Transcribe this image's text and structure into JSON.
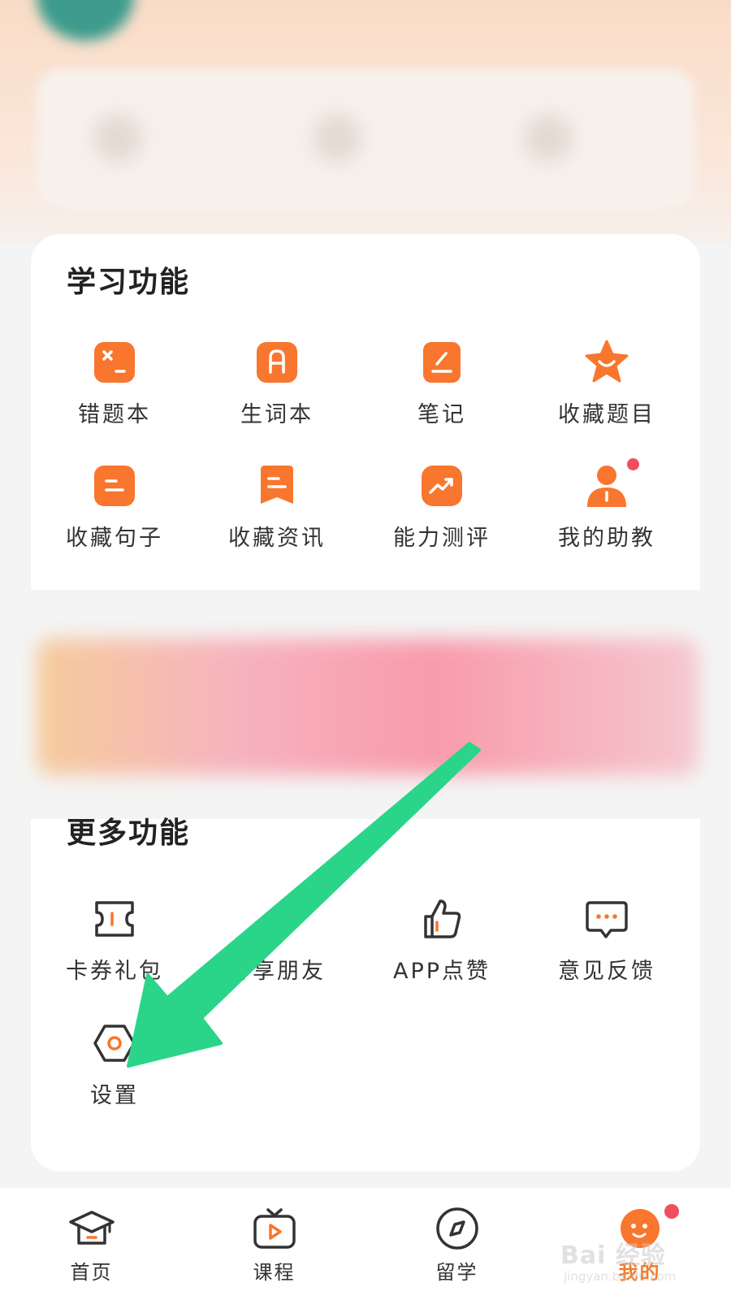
{
  "learning_section": {
    "title": "学习功能",
    "items": [
      {
        "label": "错题本",
        "icon": "wrong-question-book-icon"
      },
      {
        "label": "生词本",
        "icon": "vocabulary-book-icon"
      },
      {
        "label": "笔记",
        "icon": "notes-icon"
      },
      {
        "label": "收藏题目",
        "icon": "star-icon"
      },
      {
        "label": "收藏句子",
        "icon": "sentence-icon"
      },
      {
        "label": "收藏资讯",
        "icon": "bookmark-news-icon"
      },
      {
        "label": "能力测评",
        "icon": "trend-chart-icon"
      },
      {
        "label": "我的助教",
        "icon": "assistant-person-icon",
        "has_notification_dot": true
      }
    ]
  },
  "more_section": {
    "title": "更多功能",
    "items": [
      {
        "label": "卡券礼包",
        "icon": "coupon-ticket-icon"
      },
      {
        "label": "分享朋友",
        "icon": "share-icon"
      },
      {
        "label": "APP点赞",
        "icon": "thumbs-up-icon"
      },
      {
        "label": "意见反馈",
        "icon": "feedback-chat-icon"
      },
      {
        "label": "设置",
        "icon": "settings-hexagon-icon"
      }
    ]
  },
  "tab_bar": {
    "tabs": [
      {
        "label": "首页",
        "icon": "graduation-cap-icon"
      },
      {
        "label": "课程",
        "icon": "video-play-icon"
      },
      {
        "label": "留学",
        "icon": "compass-icon"
      },
      {
        "label": "我的",
        "icon": "mascot-avatar-icon",
        "active": true,
        "has_notification_dot": true
      }
    ]
  },
  "watermark": {
    "main": "Bai 经验",
    "sub": "jingyan.baidu.com"
  },
  "colors": {
    "accent": "#f37b2c",
    "icon_orange": "#f8762d",
    "arrow_green": "#2ad58a",
    "notification_red": "#f24d5c"
  }
}
